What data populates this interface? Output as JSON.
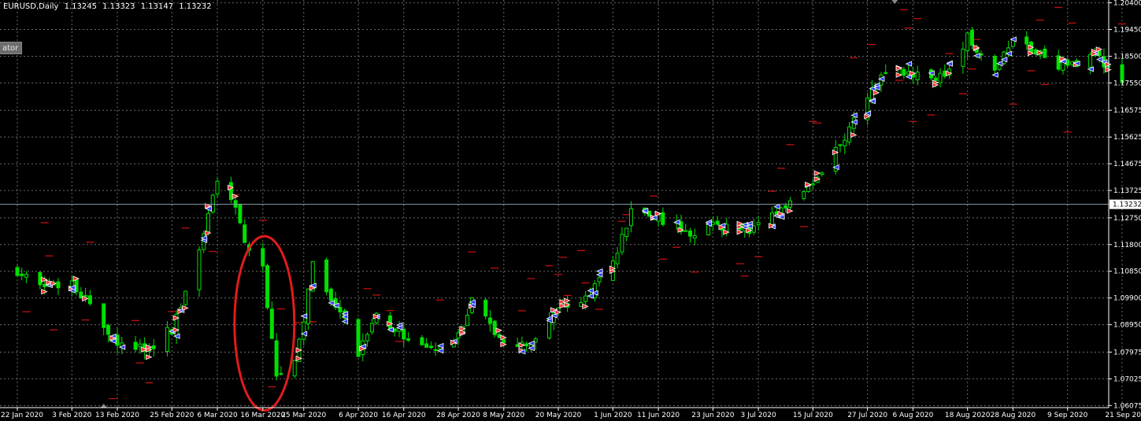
{
  "header": {
    "symbol": "EURUSD,Daily",
    "open": "1.13245",
    "high": "1.13323",
    "low": "1.13147",
    "close": "1.13232"
  },
  "side_tag": {
    "label": "ator"
  },
  "colors": {
    "background": "#000000",
    "grid": "#6b6b6b",
    "bull_candle": "#00e000",
    "bear_candle": "#00e000",
    "price_line": "#8ca0b4",
    "price_tag_bg": "#ffffff",
    "price_tag_text": "#000000",
    "sell_marker": "#ff3030",
    "buy_marker": "#2a3cff",
    "level_dash": "#c01010",
    "highlight_ellipse": "#e01c1c",
    "axis_text": "#ffffff"
  },
  "chart_data": {
    "type": "candlestick",
    "series_name": "EURUSD",
    "timeframe": "Daily",
    "ylim": [
      1.06,
      1.205
    ],
    "y_ticks": [
      "1.20400",
      "1.19450",
      "1.18500",
      "1.17550",
      "1.16575",
      "1.15625",
      "1.14675",
      "1.13725",
      "1.12750",
      "1.11800",
      "1.10850",
      "1.09900",
      "1.08950",
      "1.07975",
      "1.07025",
      "1.06075"
    ],
    "current_price": "1.13232",
    "x_labels": [
      "22 Jan 2020",
      "3 Feb 2020",
      "13 Feb 2020",
      "25 Feb 2020",
      "6 Mar 2020",
      "16 Mar 2020",
      "25 Mar 2020",
      "6 Apr 2020",
      "16 Apr 2020",
      "28 Apr 2020",
      "8 May 2020",
      "20 May 2020",
      "1 Jun 2020",
      "11 Jun 2020",
      "23 Jun 2020",
      "3 Jul 2020",
      "15 Jul 2020",
      "27 Jul 2020",
      "6 Aug 2020",
      "18 Aug 2020",
      "28 Aug 2020",
      "9 Sep 2020",
      "21 Sep 20"
    ],
    "close_path": [
      [
        "22 Jan 2020",
        1.109
      ],
      [
        "27 Jan 2020",
        1.102
      ],
      [
        "3 Feb 2020",
        1.105
      ],
      [
        "7 Feb 2020",
        1.096
      ],
      [
        "13 Feb 2020",
        1.084
      ],
      [
        "19 Feb 2020",
        1.08
      ],
      [
        "25 Feb 2020",
        1.088
      ],
      [
        "2 Mar 2020",
        1.115
      ],
      [
        "6 Mar 2020",
        1.14
      ],
      [
        "10 Mar 2020",
        1.13
      ],
      [
        "13 Mar 2020",
        1.115
      ],
      [
        "16 Mar 2020",
        1.11
      ],
      [
        "19 Mar 2020",
        1.07
      ],
      [
        "23 Mar 2020",
        1.075
      ],
      [
        "25 Mar 2020",
        1.09
      ],
      [
        "27 Mar 2020",
        1.112
      ],
      [
        "31 Mar 2020",
        1.1
      ],
      [
        "6 Apr 2020",
        1.08
      ],
      [
        "10 Apr 2020",
        1.093
      ],
      [
        "16 Apr 2020",
        1.086
      ],
      [
        "22 Apr 2020",
        1.08
      ],
      [
        "28 Apr 2020",
        1.085
      ],
      [
        "1 May 2020",
        1.098
      ],
      [
        "8 May 2020",
        1.083
      ],
      [
        "14 May 2020",
        1.081
      ],
      [
        "20 May 2020",
        1.096
      ],
      [
        "26 May 2020",
        1.099
      ],
      [
        "1 Jun 2020",
        1.112
      ],
      [
        "5 Jun 2020",
        1.13
      ],
      [
        "11 Jun 2020",
        1.128
      ],
      [
        "17 Jun 2020",
        1.122
      ],
      [
        "23 Jun 2020",
        1.125
      ],
      [
        "29 Jun 2020",
        1.123
      ],
      [
        "3 Jul 2020",
        1.125
      ],
      [
        "9 Jul 2020",
        1.13
      ],
      [
        "15 Jul 2020",
        1.14
      ],
      [
        "21 Jul 2020",
        1.153
      ],
      [
        "27 Jul 2020",
        1.17
      ],
      [
        "31 Jul 2020",
        1.18
      ],
      [
        "6 Aug 2020",
        1.178
      ],
      [
        "12 Aug 2020",
        1.177
      ],
      [
        "18 Aug 2020",
        1.192
      ],
      [
        "24 Aug 2020",
        1.181
      ],
      [
        "28 Aug 2020",
        1.19
      ],
      [
        "3 Sep 2020",
        1.185
      ],
      [
        "9 Sep 2020",
        1.181
      ],
      [
        "15 Sep 2020",
        1.185
      ],
      [
        "21 Sep 2020",
        1.175
      ]
    ]
  }
}
